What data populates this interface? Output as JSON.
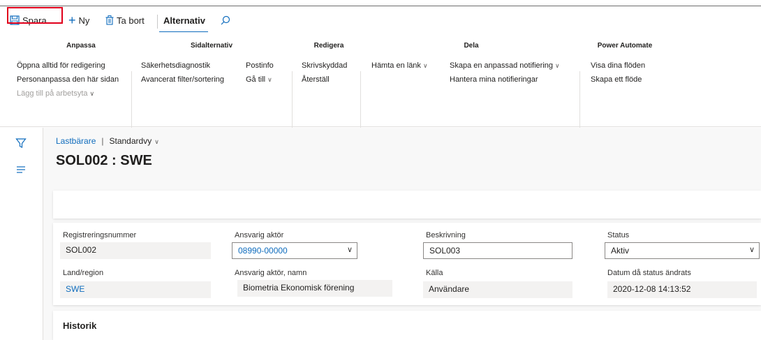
{
  "toolbar": {
    "save_label": "Spara",
    "new_label": "Ny",
    "delete_label": "Ta bort",
    "options_tab_label": "Alternativ",
    "search_icon": "search-icon"
  },
  "ribbon": {
    "groups": {
      "anpassa": {
        "title": "Anpassa",
        "items": [
          "Öppna alltid för redigering",
          "Personanpassa den här sidan",
          "Lägg till på arbetsyta"
        ]
      },
      "sidalternativ": {
        "title": "Sidalternativ",
        "items": [
          "Säkerhetsdiagnostik",
          "Avancerat filter/sortering",
          "Postinfo",
          "Gå till"
        ]
      },
      "redigera": {
        "title": "Redigera",
        "items": [
          "Skrivskyddad",
          "Återställ"
        ]
      },
      "dela": {
        "title": "Dela",
        "items": [
          "Hämta en länk",
          "Skapa en anpassad notifiering",
          "Hantera mina notifieringar"
        ]
      },
      "power_automate": {
        "title": "Power Automate",
        "items": [
          "Visa dina flöden",
          "Skapa ett flöde"
        ]
      }
    }
  },
  "breadcrumb": {
    "entity": "Lastbärare",
    "separator": "|",
    "view": "Standardvy"
  },
  "page_title": "SOL002 : SWE",
  "form": {
    "registreringsnummer": {
      "label": "Registreringsnummer",
      "value": "SOL002"
    },
    "ansvarig_aktor": {
      "label": "Ansvarig aktör",
      "value": "08990-00000"
    },
    "beskrivning": {
      "label": "Beskrivning",
      "value": "SOL003"
    },
    "status": {
      "label": "Status",
      "value": "Aktiv"
    },
    "land_region": {
      "label": "Land/region",
      "value": "SWE"
    },
    "ansvarig_aktor_namn": {
      "label": "Ansvarig aktör, namn",
      "value": "Biometria Ekonomisk förening"
    },
    "kalla": {
      "label": "Källa",
      "value": "Användare"
    },
    "datum_status": {
      "label": "Datum då status ändrats",
      "value": "2020-12-08 14:13:52"
    }
  },
  "history": {
    "title": "Historik"
  },
  "colors": {
    "accent": "#0f6cbd",
    "highlight": "#e0001b"
  }
}
